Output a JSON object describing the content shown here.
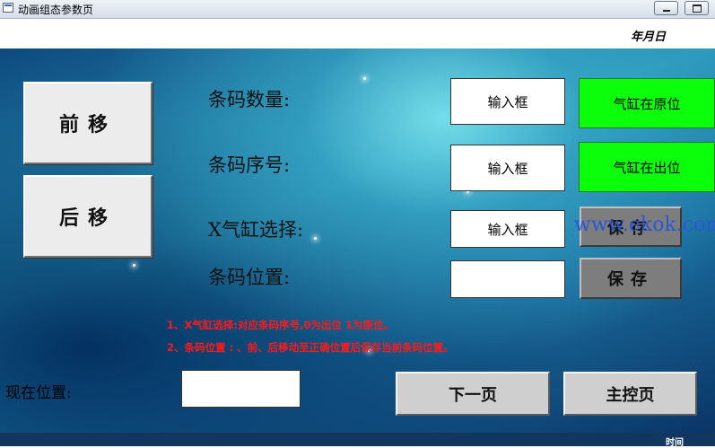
{
  "window": {
    "title": "动画组态参数页"
  },
  "header": {
    "date_label": "年月日"
  },
  "buttons": {
    "forward": "前移",
    "backward": "后移",
    "save": "保存",
    "next_page": "下一页",
    "main_control": "主控页"
  },
  "fields": {
    "barcode_count": {
      "label": "条码数量:",
      "value": "输入框"
    },
    "barcode_serial": {
      "label": "条码序号:",
      "value": "输入框"
    },
    "x_cylinder": {
      "label": "X气缸选择:",
      "value": "输入框"
    },
    "barcode_position": {
      "label": "条码位置:",
      "value": ""
    }
  },
  "status": {
    "home": {
      "text": "气缸在原位",
      "color": "#0bff0b"
    },
    "out": {
      "text": "气缸在出位",
      "color": "#0bff0b"
    }
  },
  "watermark": "www.ekok.com",
  "notes": [
    "1、X气缸选择:对应条码序号,0为出位 1为原位。",
    "2、条码位置 : 、前、后移动至正确位置后保存当前条码位置。"
  ],
  "current_position": {
    "label": "现在位置:",
    "value": ""
  },
  "footer": {
    "time_label": "时间"
  }
}
